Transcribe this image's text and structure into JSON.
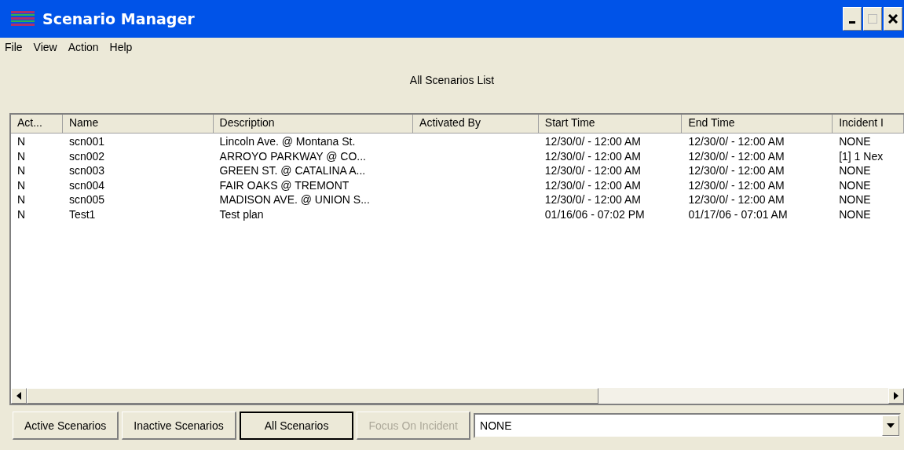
{
  "window": {
    "title": "Scenario Manager"
  },
  "menu": [
    "File",
    "View",
    "Action",
    "Help"
  ],
  "list_title": "All Scenarios List",
  "table": {
    "columns": [
      "Act...",
      "Name",
      "Description",
      "Activated By",
      "Start Time",
      "End Time",
      "Incident I"
    ],
    "rows": [
      [
        "N",
        "scn001",
        "Lincoln Ave. @ Montana St.",
        "",
        "12/30/0/ - 12:00 AM",
        "12/30/0/ - 12:00 AM",
        "NONE"
      ],
      [
        "N",
        "scn002",
        "ARROYO PARKWAY @ CO...",
        "",
        "12/30/0/ - 12:00 AM",
        "12/30/0/ - 12:00 AM",
        "[1] 1 Nex"
      ],
      [
        "N",
        "scn003",
        "GREEN ST. @ CATALINA A...",
        "",
        "12/30/0/ - 12:00 AM",
        "12/30/0/ - 12:00 AM",
        "NONE"
      ],
      [
        "N",
        "scn004",
        "FAIR OAKS @ TREMONT",
        "",
        "12/30/0/ - 12:00 AM",
        "12/30/0/ - 12:00 AM",
        "NONE"
      ],
      [
        "N",
        "scn005",
        "MADISON AVE. @ UNION S...",
        "",
        "12/30/0/ - 12:00 AM",
        "12/30/0/ - 12:00 AM",
        "NONE"
      ],
      [
        "N",
        "Test1",
        "Test plan",
        "",
        "01/16/06 - 07:02 PM",
        "01/17/06 - 07:01 AM",
        "NONE"
      ]
    ]
  },
  "filters": [
    {
      "label": "Active Scenarios",
      "selected": false
    },
    {
      "label": "Inactive Scenarios",
      "selected": false
    },
    {
      "label": "All Scenarios",
      "selected": true
    }
  ],
  "focus_button": {
    "label": "Focus On Incident",
    "disabled": true
  },
  "incident_select": {
    "value": "NONE"
  }
}
